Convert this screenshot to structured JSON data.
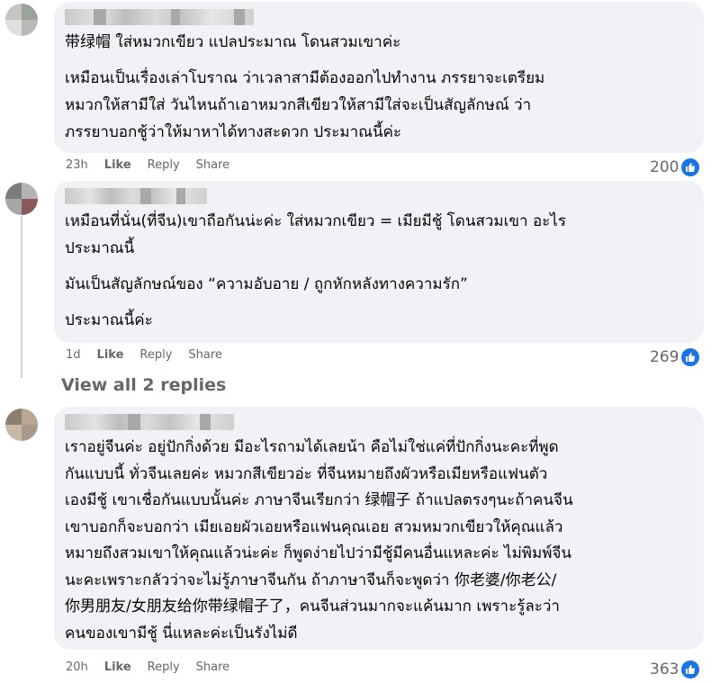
{
  "comments": [
    {
      "lines": [
        "带绿帽 ใส่หมวกเขียว แปลประมาณ โดนสวมเขาค่ะ",
        "",
        "เหมือนเป็นเรื่องเล่าโบราณ ว่าเวลาสามีต้องออกไปทำงาน ภรรยาจะเตรียม",
        "หมวกให้สามีใส่ วันไหนถ้าเอาหมวกสีเขียวให้สามีใส่จะเป็นสัญลักษณ์ ว่า",
        "ภรรยาบอกชู้ว่าให้มาหาได้ทางสะดวก ประมาณนี้ค่ะ"
      ],
      "time": "23h",
      "like_label": "Like",
      "reply_label": "Reply",
      "share_label": "Share",
      "reaction_count": "200"
    },
    {
      "lines": [
        "เหมือนที่นั่น(ที่จีน)เขาถือกันน่ะค่ะ ใส่หมวกเขียว = เมียมีชู้ โดนสวมเขา อะไร",
        "ประมาณนี้",
        "",
        "มันเป็นสัญลักษณ์ของ “ความอับอาย / ถูกหักหลังทางความรัก”",
        "",
        "ประมาณนี้ค่ะ"
      ],
      "time": "1d",
      "like_label": "Like",
      "reply_label": "Reply",
      "share_label": "Share",
      "reaction_count": "269"
    },
    {
      "lines": [
        "เราอยู่จีนค่ะ อยู่ปักกิ่งด้วย มีอะไรถามได้เลยน้า คือไม่ใช่แค่ที่ปักกิ่งนะคะที่พูด",
        "กันแบบนี้ ทั่วจีนเลยค่ะ หมวกสีเขียวอ่ะ ที่จีนหมายถึงผัวหรือเมียหรือแฟนตัว",
        "เองมีชู้ เขาเชื่อกันแบบนั้นค่ะ ภาษาจีนเรียกว่า 绿帽子 ถ้าแปลตรงๆนะถ้าคนจีน",
        "เขาบอกก็จะบอกว่า เมียเอยผัวเอยหรือแฟนคุณเอย สวมหมวกเขียวให้คุณแล้ว",
        "หมายถึงสวมเขาให้คุณแล้วน่ะค่ะ ก็พูดง่ายไปว่ามีชู้มีคนอื่นแหละค่ะ ไม่พิมพ์จีน",
        "นะคะเพราะกลัวว่าจะไม่รู้ภาษาจีนกัน ถ้าภาษาจีนก็จะพูดว่า 你老婆/你老公/",
        "你男朋友/女朋友给你带绿帽子了，คนจีนส่วนมากจะแค้นมาก เพราะรู้ละว่า",
        "คนของเขามีชู้ นี่แหละค่ะเป็นรังไม่ดี"
      ],
      "time": "20h",
      "like_label": "Like",
      "reply_label": "Reply",
      "share_label": "Share",
      "reaction_count": "363"
    }
  ],
  "view_replies_label": "View all 2 replies",
  "colors": {
    "bubble": "#f0f2f5",
    "muted_text": "#65676b",
    "like_blue": "#1b74e4"
  },
  "icons": [
    "like-reaction-icon"
  ]
}
